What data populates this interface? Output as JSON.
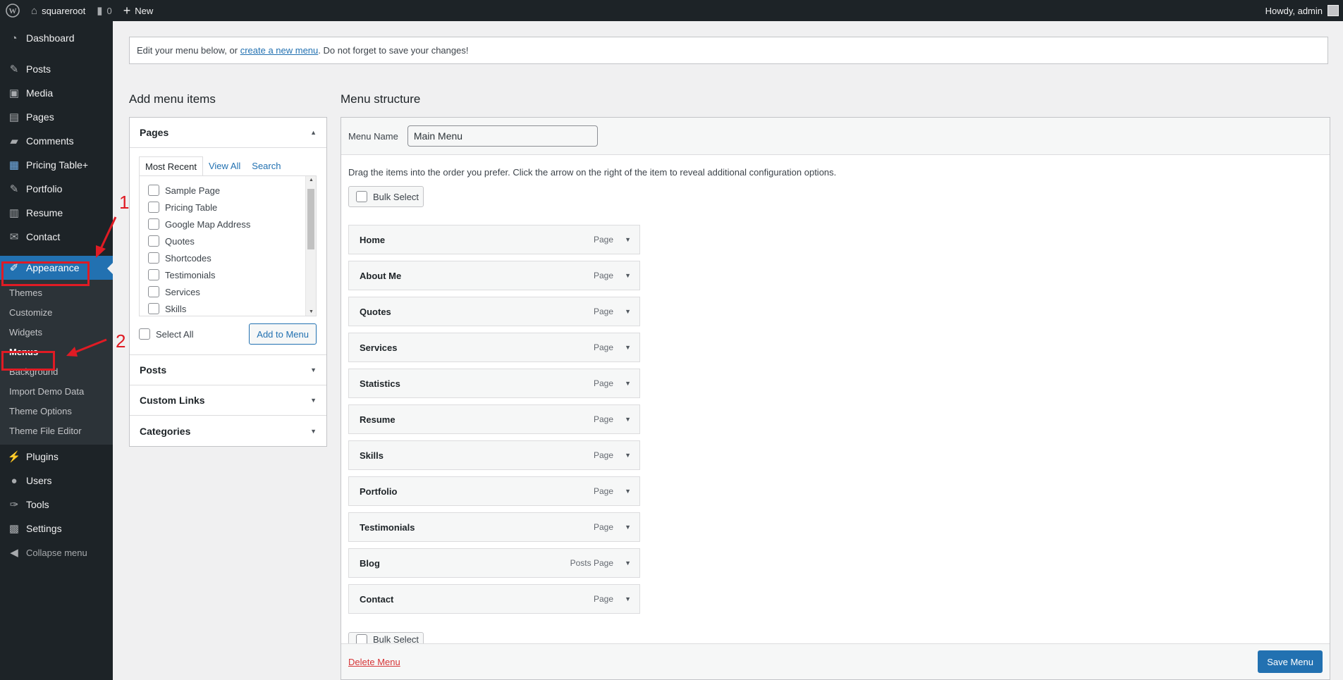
{
  "adminbar": {
    "site_name": "squareroot",
    "comments_count": "0",
    "new_label": "New",
    "greeting": "Howdy, admin"
  },
  "sidebar": {
    "items": [
      {
        "label": "Dashboard",
        "icon": "dashboard-icon"
      },
      {
        "label": "Posts",
        "icon": "pin-icon"
      },
      {
        "label": "Media",
        "icon": "media-icon"
      },
      {
        "label": "Pages",
        "icon": "pages-icon"
      },
      {
        "label": "Comments",
        "icon": "comment-icon"
      },
      {
        "label": "Pricing Table+",
        "icon": "table-icon"
      },
      {
        "label": "Portfolio",
        "icon": "pin-icon"
      },
      {
        "label": "Resume",
        "icon": "book-icon"
      },
      {
        "label": "Contact",
        "icon": "mail-icon"
      },
      {
        "label": "Appearance",
        "icon": "brush-icon"
      }
    ],
    "submenu": [
      "Themes",
      "Customize",
      "Widgets",
      "Menus",
      "Background",
      "Import Demo Data",
      "Theme Options",
      "Theme File Editor"
    ],
    "bottom_items": [
      {
        "label": "Plugins",
        "icon": "plugin-icon"
      },
      {
        "label": "Users",
        "icon": "user-icon"
      },
      {
        "label": "Tools",
        "icon": "wrench-icon"
      },
      {
        "label": "Settings",
        "icon": "settings-icon"
      }
    ],
    "collapse_label": "Collapse menu"
  },
  "annotations": {
    "one": "1",
    "two": "2"
  },
  "notice": {
    "before": "Edit your menu below, or ",
    "link": "create a new menu",
    "after": ". Do not forget to save your changes!"
  },
  "left": {
    "title": "Add menu items",
    "pages_heading": "Pages",
    "tabs": [
      "Most Recent",
      "View All",
      "Search"
    ],
    "pages": [
      "Sample Page",
      "Pricing Table",
      "Google Map Address",
      "Quotes",
      "Shortcodes",
      "Testimonials",
      "Services",
      "Skills"
    ],
    "select_all": "Select All",
    "add_button": "Add to Menu",
    "sections": [
      "Posts",
      "Custom Links",
      "Categories"
    ]
  },
  "right": {
    "title": "Menu structure",
    "name_label": "Menu Name",
    "name_value": "Main Menu",
    "instructions": "Drag the items into the order you prefer. Click the arrow on the right of the item to reveal additional configuration options.",
    "bulk_select": "Bulk Select",
    "items": [
      {
        "title": "Home",
        "type": "Page"
      },
      {
        "title": "About Me",
        "type": "Page"
      },
      {
        "title": "Quotes",
        "type": "Page"
      },
      {
        "title": "Services",
        "type": "Page"
      },
      {
        "title": "Statistics",
        "type": "Page"
      },
      {
        "title": "Resume",
        "type": "Page"
      },
      {
        "title": "Skills",
        "type": "Page"
      },
      {
        "title": "Portfolio",
        "type": "Page"
      },
      {
        "title": "Testimonials",
        "type": "Page"
      },
      {
        "title": "Blog",
        "type": "Posts Page"
      },
      {
        "title": "Contact",
        "type": "Page"
      }
    ],
    "delete_label": "Delete Menu",
    "save_label": "Save Menu"
  },
  "colors": {
    "accent": "#2271b1",
    "sidebar_bg": "#1d2327",
    "annotation": "#e01b24"
  }
}
